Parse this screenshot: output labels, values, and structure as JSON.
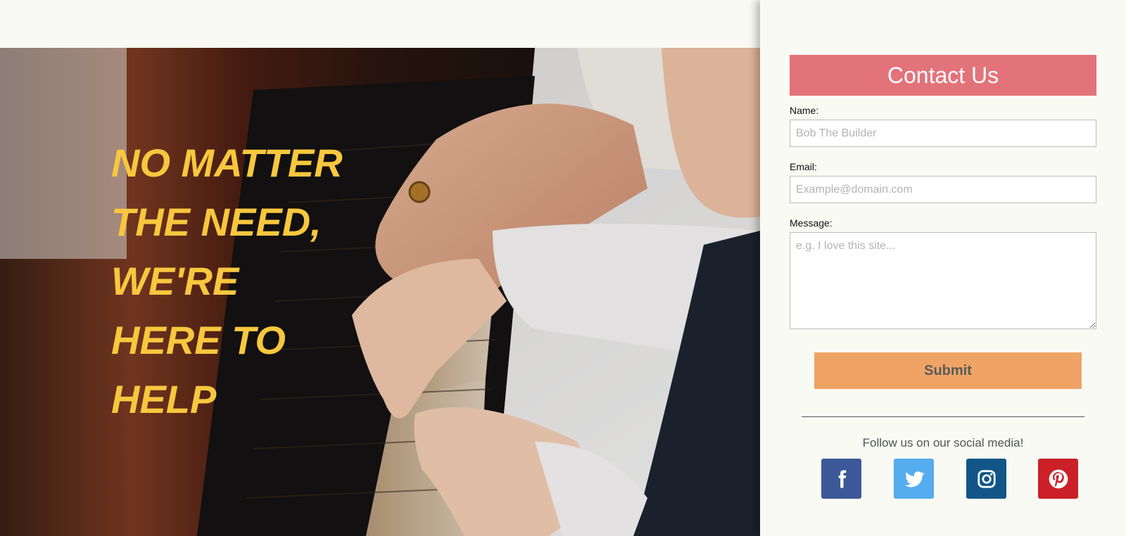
{
  "hero": {
    "headline": "NO MATTER THE NEED, WE'RE HERE TO HELP"
  },
  "contact": {
    "title": "Contact Us",
    "name_label": "Name:",
    "name_placeholder": "Bob The Builder",
    "email_label": "Email:",
    "email_placeholder": "Example@domain.com",
    "message_label": "Message:",
    "message_placeholder": "e.g. I love this site...",
    "submit_label": "Submit"
  },
  "social": {
    "caption": "Follow us on our social media!",
    "items": [
      {
        "name": "facebook",
        "icon": "facebook-icon",
        "color": "#3b5998"
      },
      {
        "name": "twitter",
        "icon": "twitter-icon",
        "color": "#55acee"
      },
      {
        "name": "instagram",
        "icon": "instagram-icon",
        "color": "#125688"
      },
      {
        "name": "pinterest",
        "icon": "pinterest-icon",
        "color": "#cb2027"
      }
    ]
  },
  "colors": {
    "headline": "#f8c73e",
    "title_bar": "#e3737a",
    "submit": "#efa466",
    "background": "#f9faf3"
  }
}
